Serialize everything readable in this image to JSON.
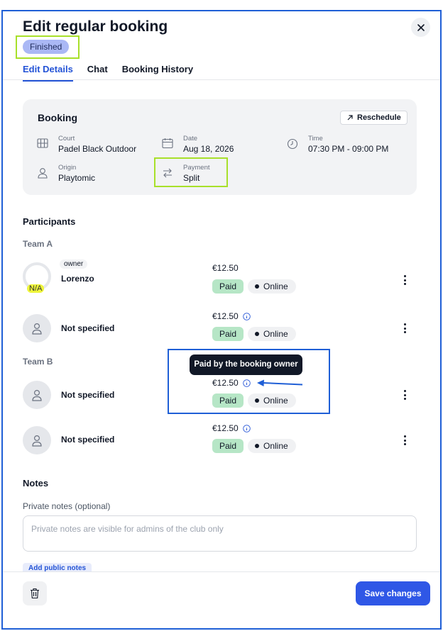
{
  "dialog": {
    "title": "Edit regular booking",
    "status": "Finished",
    "close_icon": "close-icon"
  },
  "tabs": [
    {
      "label": "Edit Details",
      "active": true
    },
    {
      "label": "Chat",
      "active": false
    },
    {
      "label": "Booking History",
      "active": false
    }
  ],
  "booking": {
    "title": "Booking",
    "reschedule_label": "Reschedule",
    "court": {
      "label": "Court",
      "value": "Padel Black Outdoor",
      "icon": "court-icon"
    },
    "date": {
      "label": "Date",
      "value": "Aug 18, 2026",
      "icon": "calendar-icon"
    },
    "time": {
      "label": "Time",
      "value": "07:30 PM - 09:00 PM",
      "icon": "clock-icon"
    },
    "origin": {
      "label": "Origin",
      "value": "Playtomic",
      "icon": "user-icon"
    },
    "payment": {
      "label": "Payment",
      "value": "Split",
      "icon": "swap-icon"
    }
  },
  "participants": {
    "title": "Participants",
    "teams": [
      {
        "label": "Team A",
        "players": [
          {
            "name": "Lorenzo",
            "owner_tag": "owner",
            "avatar_text": "N/A",
            "price": "€12.50",
            "status": "Paid",
            "channel": "Online"
          },
          {
            "name": "Not specified",
            "price": "€12.50",
            "status": "Paid",
            "channel": "Online"
          }
        ]
      },
      {
        "label": "Team B",
        "players": [
          {
            "name": "Not specified",
            "price": "€12.50",
            "status": "Paid",
            "channel": "Online"
          },
          {
            "name": "Not specified",
            "price": "€12.50",
            "status": "Paid",
            "channel": "Online"
          }
        ]
      }
    ],
    "tooltip": "Paid by the booking owner"
  },
  "notes": {
    "title": "Notes",
    "private_label": "Private notes (optional)",
    "private_placeholder": "Private notes are visible for admins of the club only",
    "add_public_label": "Add public notes"
  },
  "footer": {
    "save_label": "Save changes",
    "delete_icon": "trash-icon"
  },
  "colors": {
    "accent": "#2f57e6",
    "paid": "#b6e6c6",
    "status_badge": "#aab8f5",
    "highlight": "#a8e02a",
    "annotation": "#1f5fd6"
  }
}
